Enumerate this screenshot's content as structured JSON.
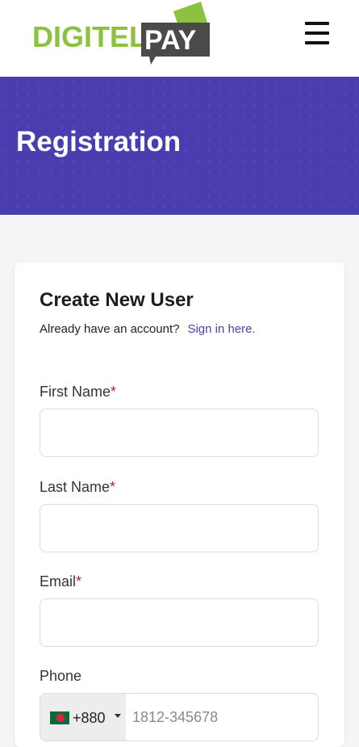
{
  "header": {
    "logo": {
      "part1": "DIGITEL",
      "part2": "PAY",
      "green": "#8cc23e",
      "dark": "#4a4a4a"
    },
    "menu_icon": "hamburger-menu-icon"
  },
  "banner": {
    "title": "Registration",
    "color": "#4a3db0"
  },
  "form": {
    "title": "Create New User",
    "signin_prompt": "Already have an account?",
    "signin_link": "Sign in here.",
    "required_mark": "*",
    "fields": {
      "first_name": {
        "label": "First Name",
        "value": ""
      },
      "last_name": {
        "label": "Last Name",
        "value": ""
      },
      "email": {
        "label": "Email",
        "value": ""
      },
      "phone": {
        "label": "Phone",
        "country_flag": "bangladesh-flag-icon",
        "dial_code": "+880",
        "placeholder": "1812-345678"
      }
    }
  }
}
